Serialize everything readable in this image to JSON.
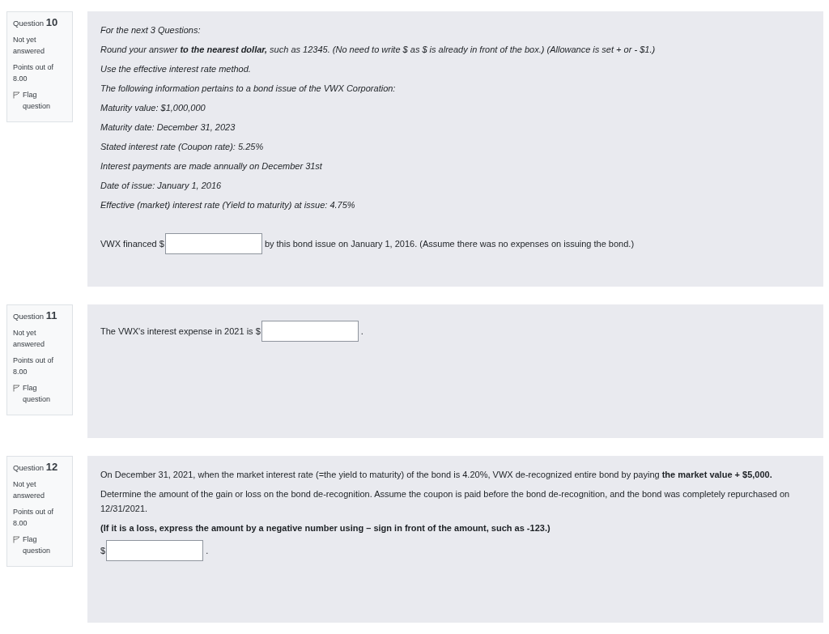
{
  "questions": [
    {
      "label": "Question",
      "number": "10",
      "status": "Not yet answered",
      "points": "Points out of 8.00",
      "flag": "Flag question",
      "flagged": false,
      "blocks": [
        {
          "kind": "para",
          "italic": true,
          "text": "For the next 3 Questions:"
        },
        {
          "kind": "para",
          "italic": true,
          "text": "Round your answer **to the nearest dollar,** such as 12345. (No need to write $ as $ is already in front of the box.) (Allowance is set + or - $1.)"
        },
        {
          "kind": "para",
          "italic": true,
          "text": "Use the effective interest rate method."
        },
        {
          "kind": "para",
          "italic": true,
          "text": "The following information pertains to a bond issue of the VWX Corporation:"
        },
        {
          "kind": "para",
          "italic": true,
          "text": "Maturity value: $1,000,000"
        },
        {
          "kind": "para",
          "italic": true,
          "text": "Maturity date: December 31, 2023"
        },
        {
          "kind": "para",
          "italic": true,
          "text": "Stated interest rate (Coupon rate): 5.25%"
        },
        {
          "kind": "para",
          "italic": true,
          "text": "Interest payments are made annually on December 31st"
        },
        {
          "kind": "para",
          "italic": true,
          "text": "Date of issue: January 1, 2016"
        },
        {
          "kind": "para",
          "italic": true,
          "text": "Effective (market) interest rate (Yield to maturity) at issue: 4.75%"
        },
        {
          "kind": "fill",
          "before": "VWX financed $",
          "after": "by this bond issue on January 1, 2016. (Assume there was no expenses on issuing the bond.)"
        }
      ]
    },
    {
      "label": "Question",
      "number": "11",
      "status": "Not yet answered",
      "points": "Points out of 8.00",
      "flag": "Flag question",
      "flagged": false,
      "blocks": [
        {
          "kind": "fill",
          "before": "The VWX's interest expense in 2021 is $",
          "after": "."
        }
      ]
    },
    {
      "label": "Question",
      "number": "12",
      "status": "Not yet answered",
      "points": "Points out of 8.00",
      "flag": "Flag question",
      "flagged": false,
      "blocks": [
        {
          "kind": "para",
          "italic": false,
          "text": "On December 31, 2021, when the market interest rate (=the yield to maturity) of the bond is 4.20%, VWX de-recognized entire bond by paying **the market value + $5,000.**"
        },
        {
          "kind": "para",
          "italic": false,
          "text": "Determine the amount of the gain or loss on the bond de-recognition. Assume the coupon is paid before the bond de-recognition, and the bond was completely repurchased on 12/31/2021."
        },
        {
          "kind": "para",
          "italic": false,
          "text": "**(If it is a loss, express the amount by a negative number using – sign in front of the amount, such as -123.)**"
        },
        {
          "kind": "fill",
          "before": "$",
          "after": "."
        }
      ]
    }
  ]
}
